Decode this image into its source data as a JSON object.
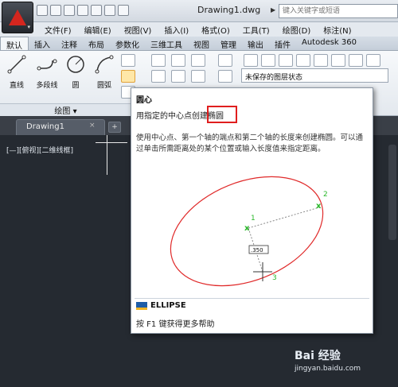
{
  "titlebar": {
    "document_title": "Drawing1.dwg",
    "search_placeholder": "键入关键字或短语"
  },
  "menu": [
    "文件(F)",
    "编辑(E)",
    "视图(V)",
    "插入(I)",
    "格式(O)",
    "工具(T)",
    "绘图(D)",
    "标注(N)"
  ],
  "ribbon_tabs": [
    "默认",
    "插入",
    "注释",
    "布局",
    "参数化",
    "三维工具",
    "视图",
    "管理",
    "输出",
    "插件",
    "Autodesk 360"
  ],
  "draw_tools": [
    {
      "label": "直线",
      "icon": "line-icon"
    },
    {
      "label": "多段线",
      "icon": "polyline-icon"
    },
    {
      "label": "圆",
      "icon": "circle-icon"
    },
    {
      "label": "圆弧",
      "icon": "arc-icon"
    }
  ],
  "layer_state": "未保存的图层状态",
  "draw_group_label": "绘图 ▾",
  "file_tab": {
    "label": "Drawing1",
    "close": "×"
  },
  "viewport_label": "[—][俯视][二维线框]",
  "tooltip": {
    "title": "圆心",
    "subtitle": "用指定的中心点创建椭圆",
    "description": "使用中心点、第一个轴的端点和第二个轴的长度来创建椭圆。可以通过单击所需距离处的某个位置或输入长度值来指定距离。",
    "illustration": {
      "point_labels": [
        "1",
        "2",
        "3"
      ],
      "dimension_value": ".350",
      "ellipse_color": "#e02a2a",
      "point_color": "#2ab82a"
    },
    "command": "ELLIPSE",
    "help": "按 F1 键获得更多帮助",
    "highlight_color": "#e01e1e"
  },
  "watermark": {
    "brand": "Bai 经验",
    "url": "jingyan.baidu.com"
  }
}
